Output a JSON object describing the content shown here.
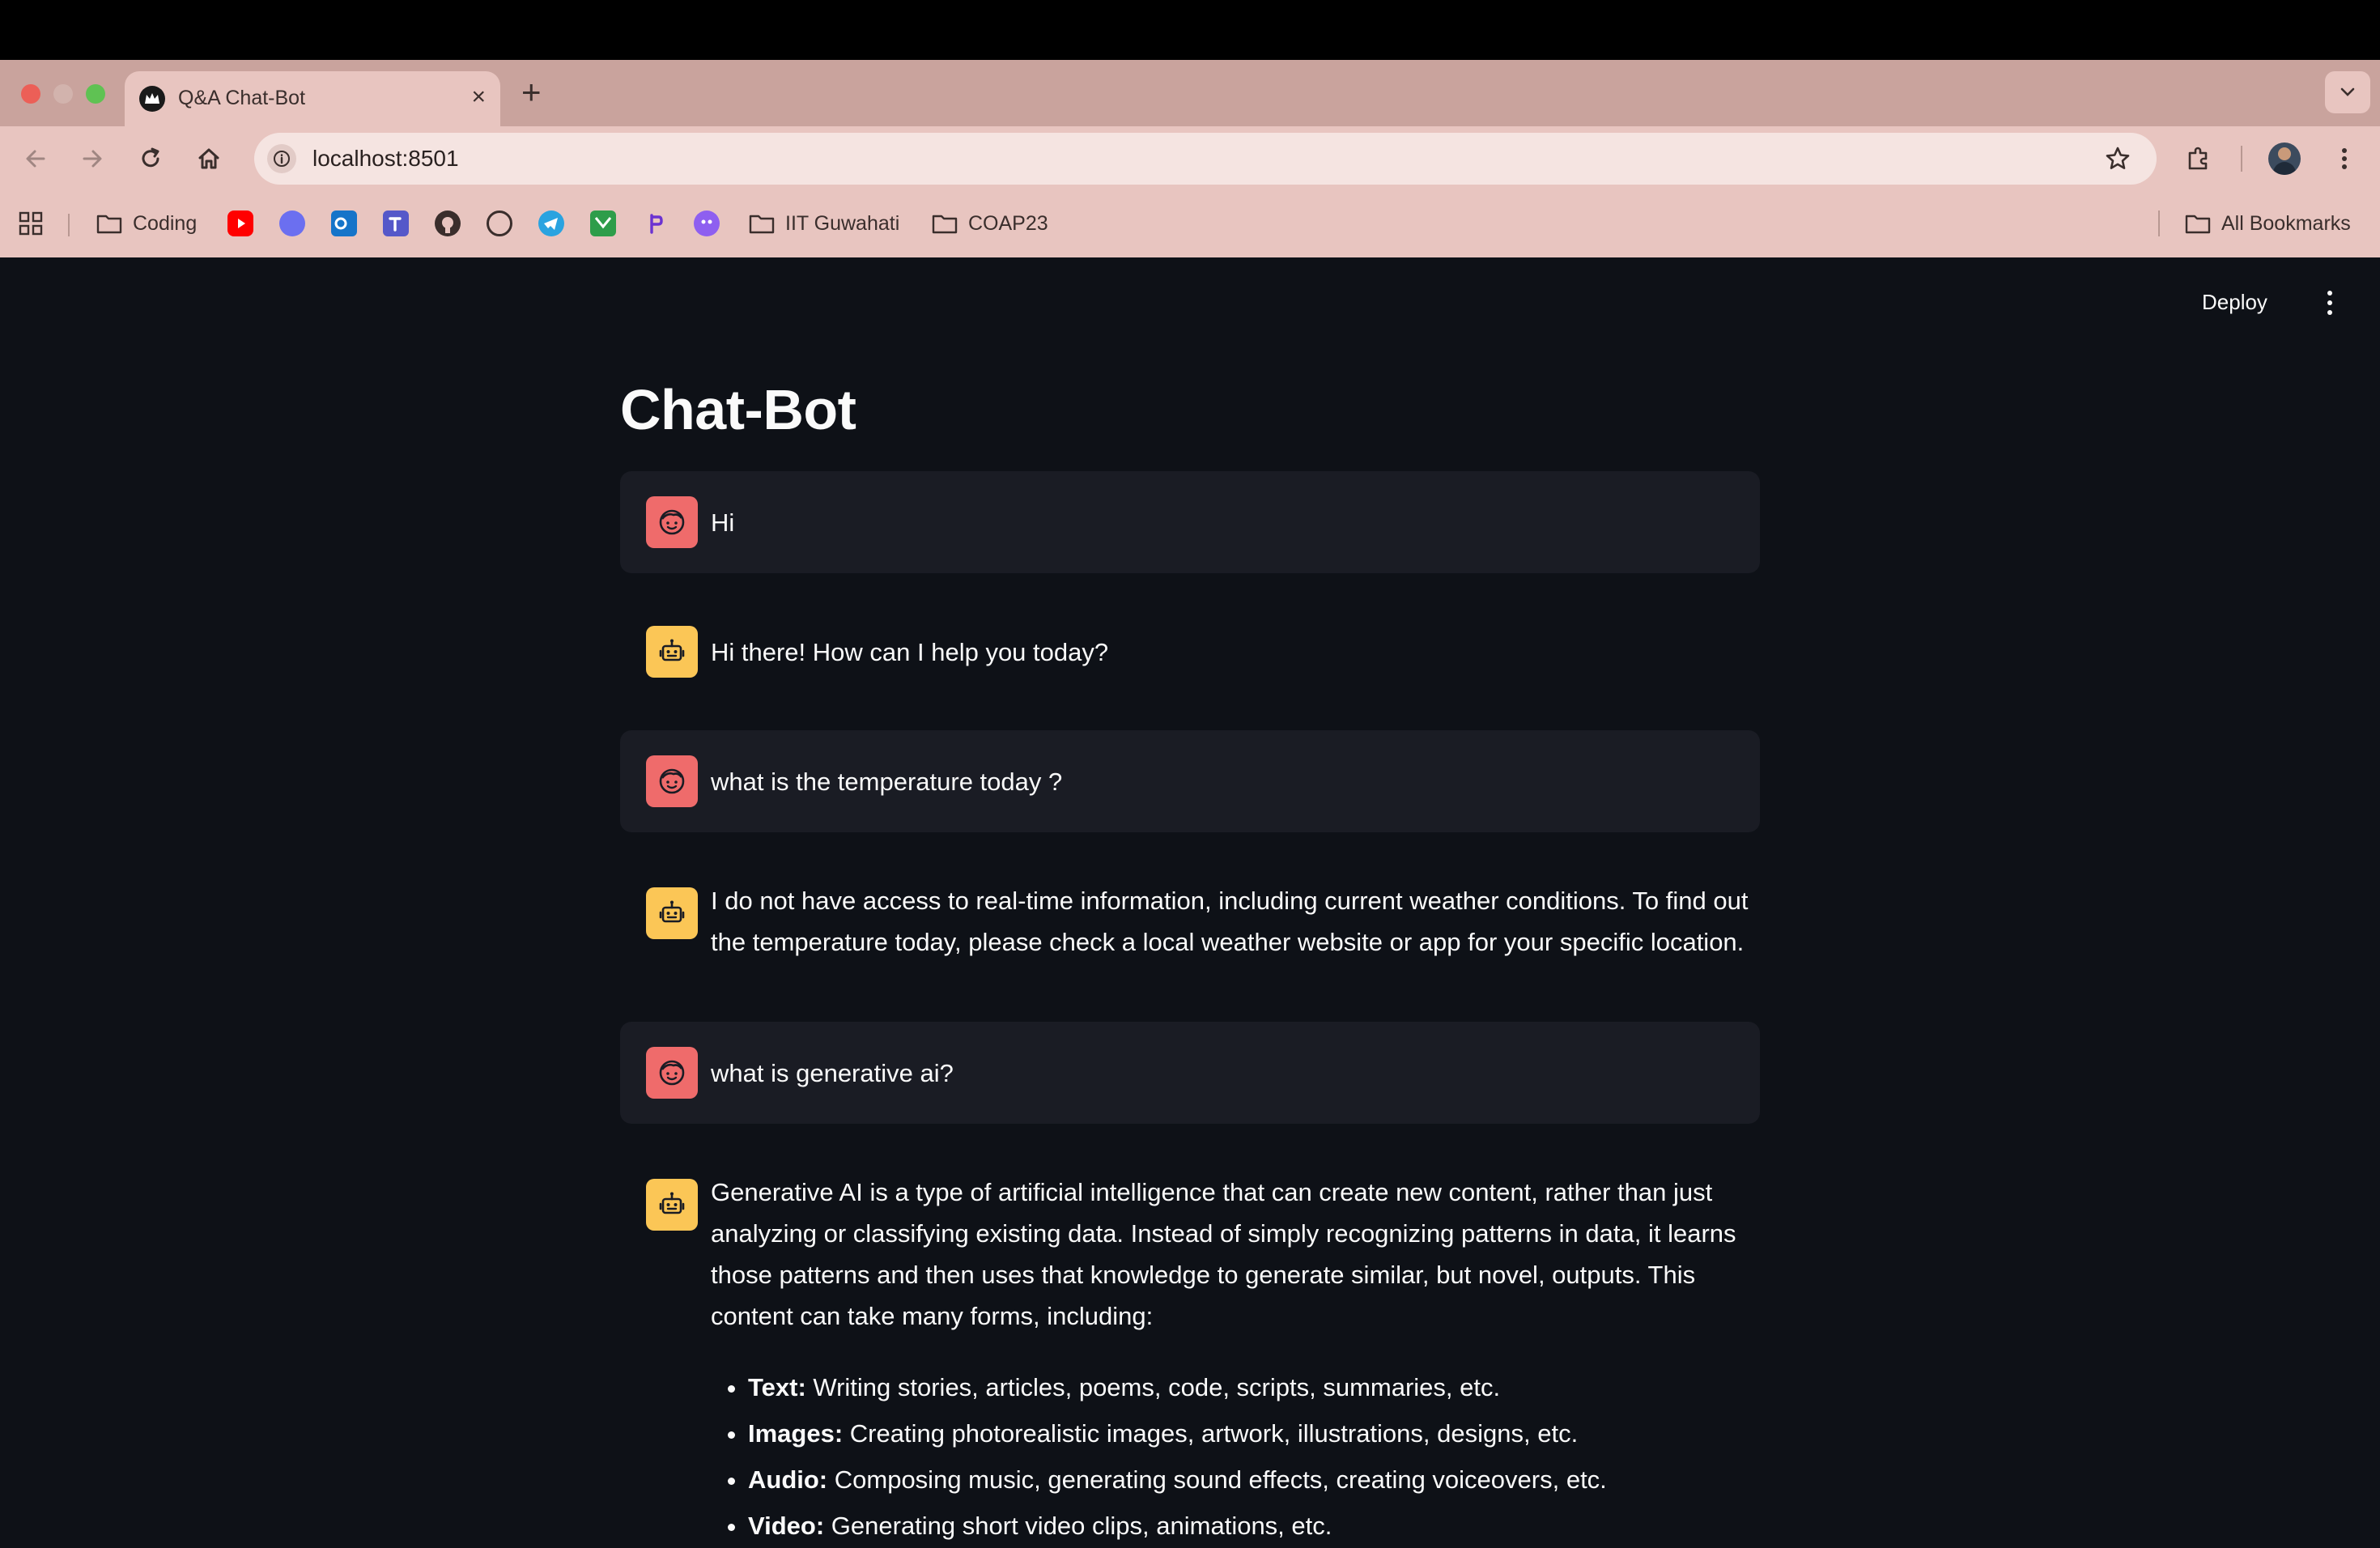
{
  "browser": {
    "tab_title": "Q&A Chat-Bot",
    "tab_close": "×",
    "new_tab": "+",
    "url": "localhost:8501",
    "bookmarks": {
      "coding": "Coding",
      "iit_guwahati": "IIT Guwahati",
      "coap23": "COAP23",
      "all_bookmarks": "All Bookmarks"
    }
  },
  "app": {
    "deploy_label": "Deploy",
    "title": "Chat-Bot",
    "messages": [
      {
        "role": "user",
        "text": "Hi"
      },
      {
        "role": "assistant",
        "text": "Hi there! How can I help you today?"
      },
      {
        "role": "user",
        "text": "what is the temperature today ?"
      },
      {
        "role": "assistant",
        "text": "I do not have access to real-time information, including current weather conditions. To find out the temperature today, please check a local weather website or app for your specific location."
      },
      {
        "role": "user",
        "text": "what is generative ai?"
      },
      {
        "role": "assistant",
        "text": "Generative AI is a type of artificial intelligence that can create new content, rather than just analyzing or classifying existing data. Instead of simply recognizing patterns in data, it learns those patterns and then uses that knowledge to generate similar, but novel, outputs. This content can take many forms, including:",
        "list": [
          {
            "term": "Text:",
            "desc": " Writing stories, articles, poems, code, scripts, summaries, etc."
          },
          {
            "term": "Images:",
            "desc": " Creating photorealistic images, artwork, illustrations, designs, etc."
          },
          {
            "term": "Audio:",
            "desc": " Composing music, generating sound effects, creating voiceovers, etc."
          },
          {
            "term": "Video:",
            "desc": " Generating short video clips, animations, etc."
          }
        ]
      }
    ]
  },
  "colors": {
    "app_background": "#0e1117",
    "user_message_background": "#1a1c24",
    "user_avatar": "#ef6b6b",
    "assistant_avatar": "#fbc656",
    "chrome_background": "#e8c5c0"
  },
  "icons": {
    "user_avatar": "face-icon",
    "assistant_avatar": "robot-icon"
  }
}
